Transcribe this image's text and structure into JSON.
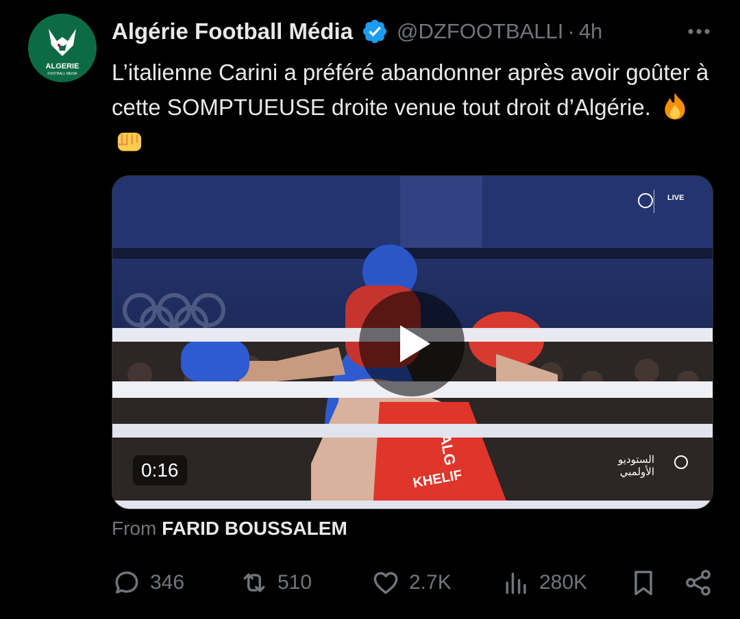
{
  "author": {
    "avatar_text": "ALGERIE",
    "avatar_subtext": "FOOTBALL MEDIA",
    "display_name": "Algérie Football Média",
    "handle": "@DZFOOTBALLI",
    "separator": "·",
    "time": "4h",
    "verified": true
  },
  "tweet": {
    "text": "L’italienne Carini a préféré abandonner après avoir goûter à cette SOMPTUEUSE droite venue tout droit d’Algérie.",
    "emojis": [
      "fire-emoji",
      "fist-emoji"
    ]
  },
  "video": {
    "duration": "0:16",
    "live_label": "LIVE",
    "studio_label": "الستوديو\nالأولمبي",
    "boxer_name": "KHELIF",
    "country_code": "ALG"
  },
  "attribution": {
    "prefix": "From",
    "source": "FARID BOUSSALEM"
  },
  "actions": {
    "replies": "346",
    "reposts": "510",
    "likes": "2.7K",
    "views": "280K"
  },
  "colors": {
    "background": "#000000",
    "text": "#e7e9ea",
    "muted": "#71767b",
    "verified": "#1d9bf0",
    "avatar": "#0d6b43"
  }
}
